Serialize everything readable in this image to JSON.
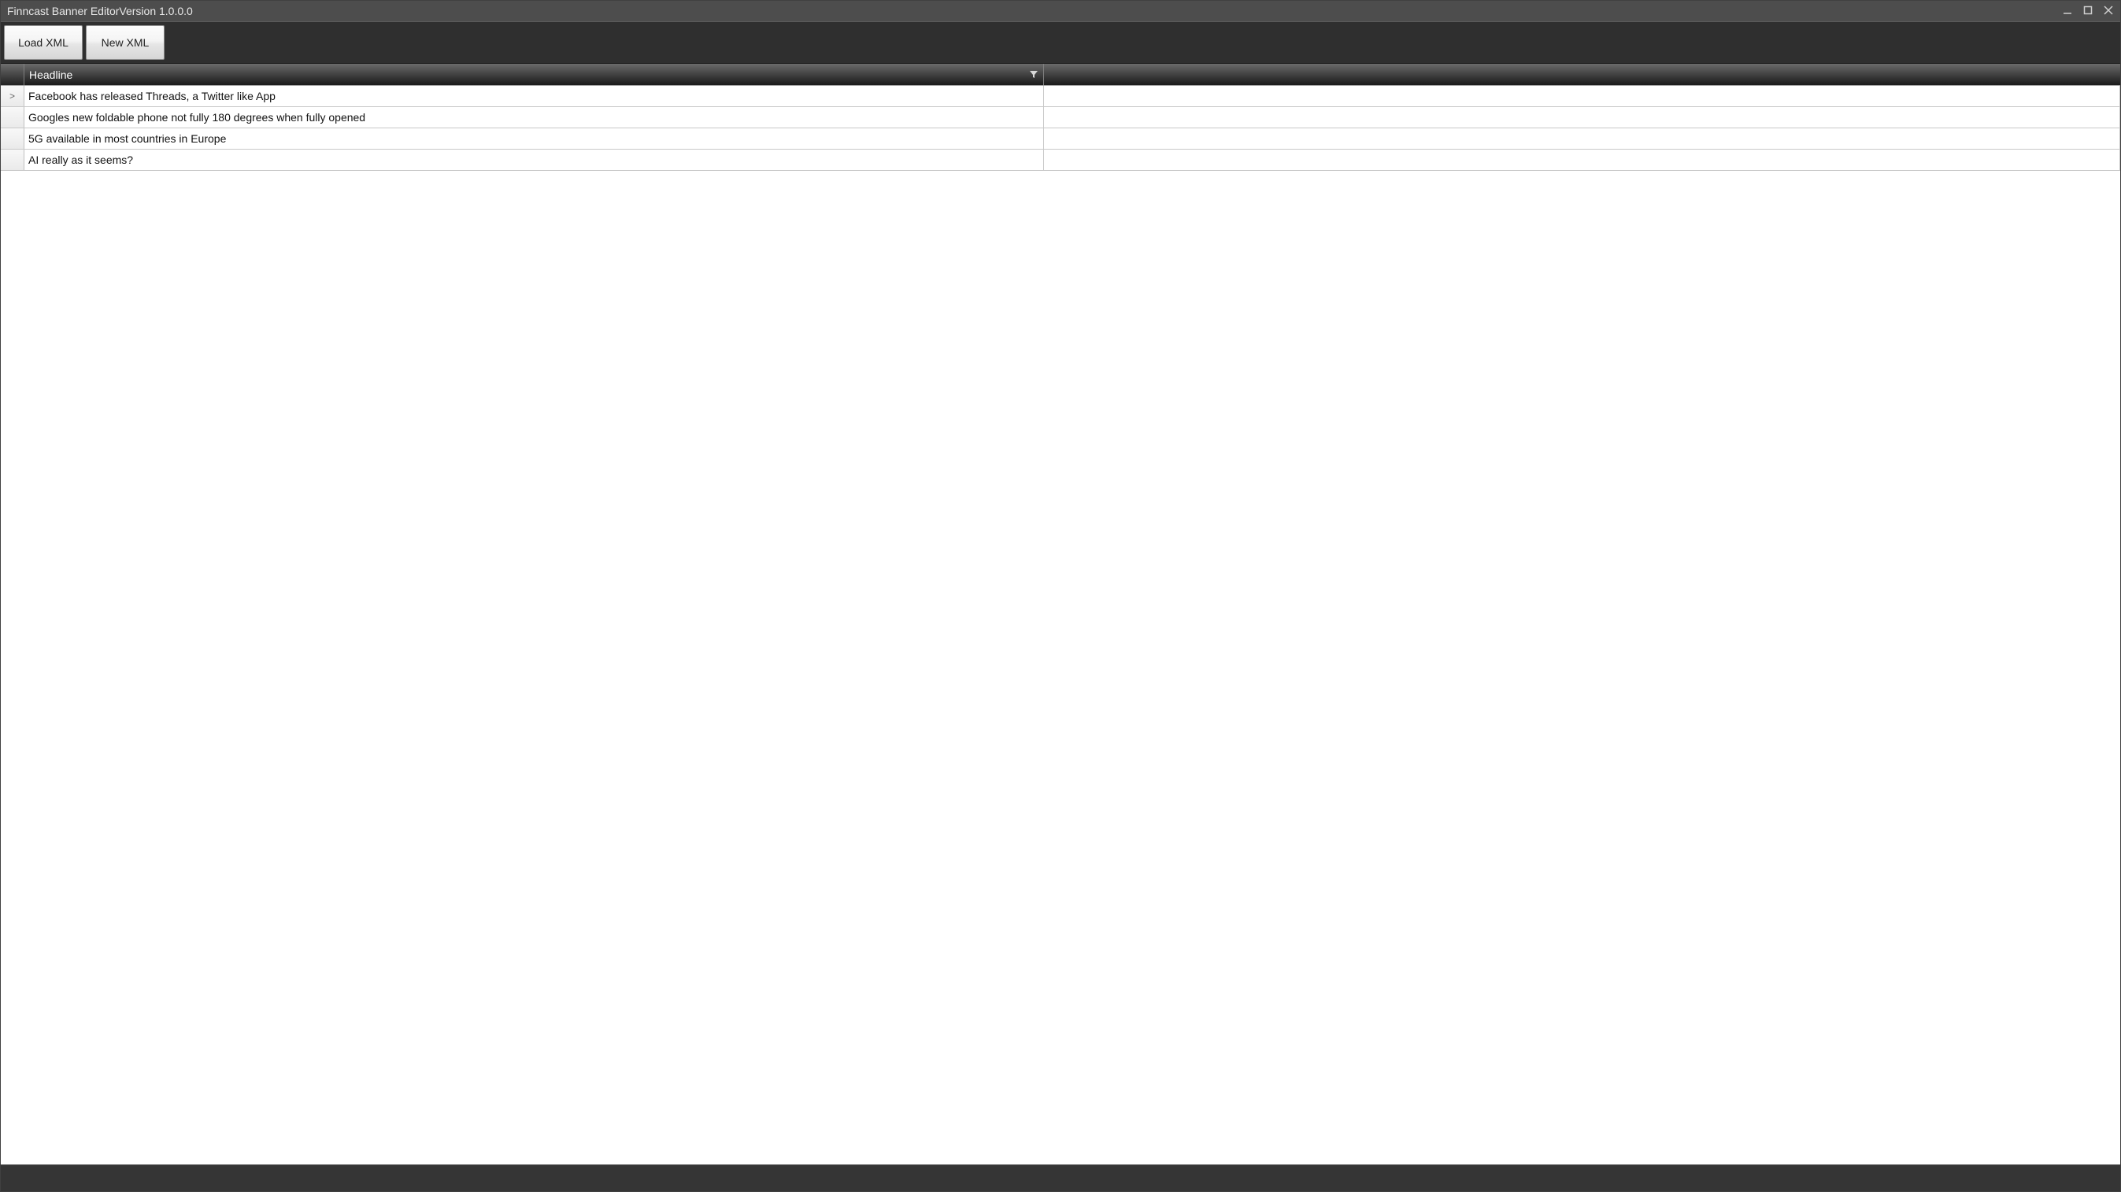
{
  "window": {
    "title": "Finncast Banner EditorVersion 1.0.0.0"
  },
  "toolbar": {
    "load_xml_label": "Load XML",
    "new_xml_label": "New XML"
  },
  "grid": {
    "columns": {
      "headline": "Headline"
    },
    "selected_indicator": ">",
    "rows": [
      {
        "headline": "Facebook has released Threads, a Twitter like App",
        "selected": true
      },
      {
        "headline": "Googles new foldable phone not fully 180 degrees when fully opened",
        "selected": false
      },
      {
        "headline": "5G available in most countries in Europe",
        "selected": false
      },
      {
        "headline": "AI really as it seems?",
        "selected": false
      }
    ]
  }
}
